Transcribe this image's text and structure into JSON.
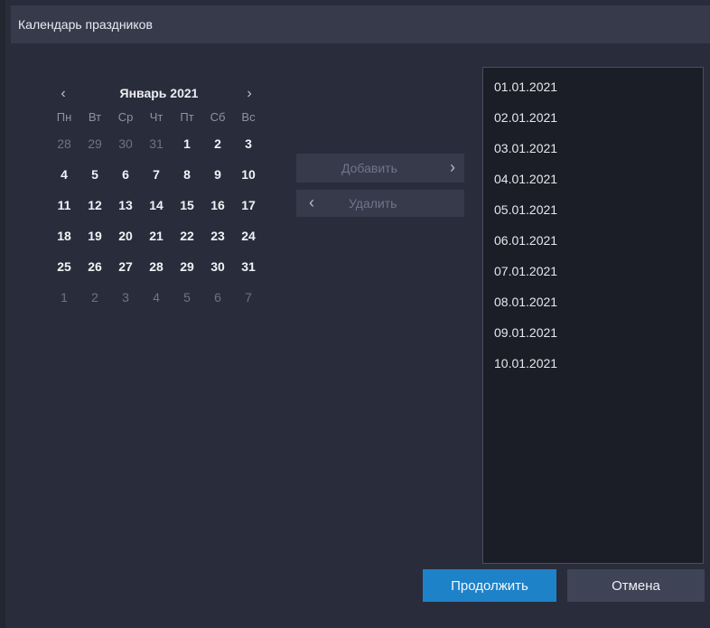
{
  "window": {
    "title": "Календарь праздников"
  },
  "calendar": {
    "month_label": "Январь 2021",
    "prev_icon": "chevron-left-icon",
    "next_icon": "chevron-right-icon",
    "weekdays": [
      "Пн",
      "Вт",
      "Ср",
      "Чт",
      "Пт",
      "Сб",
      "Вс"
    ],
    "weeks": [
      [
        {
          "d": "28",
          "out": true
        },
        {
          "d": "29",
          "out": true
        },
        {
          "d": "30",
          "out": true
        },
        {
          "d": "31",
          "out": true
        },
        {
          "d": "1"
        },
        {
          "d": "2"
        },
        {
          "d": "3"
        }
      ],
      [
        {
          "d": "4"
        },
        {
          "d": "5"
        },
        {
          "d": "6"
        },
        {
          "d": "7"
        },
        {
          "d": "8"
        },
        {
          "d": "9"
        },
        {
          "d": "10"
        }
      ],
      [
        {
          "d": "11"
        },
        {
          "d": "12"
        },
        {
          "d": "13"
        },
        {
          "d": "14"
        },
        {
          "d": "15"
        },
        {
          "d": "16"
        },
        {
          "d": "17"
        }
      ],
      [
        {
          "d": "18"
        },
        {
          "d": "19"
        },
        {
          "d": "20"
        },
        {
          "d": "21"
        },
        {
          "d": "22"
        },
        {
          "d": "23"
        },
        {
          "d": "24"
        }
      ],
      [
        {
          "d": "25"
        },
        {
          "d": "26"
        },
        {
          "d": "27"
        },
        {
          "d": "28"
        },
        {
          "d": "29"
        },
        {
          "d": "30"
        },
        {
          "d": "31"
        }
      ],
      [
        {
          "d": "1",
          "out": true
        },
        {
          "d": "2",
          "out": true
        },
        {
          "d": "3",
          "out": true
        },
        {
          "d": "4",
          "out": true
        },
        {
          "d": "5",
          "out": true
        },
        {
          "d": "6",
          "out": true
        },
        {
          "d": "7",
          "out": true
        }
      ]
    ]
  },
  "actions": {
    "add_label": "Добавить",
    "remove_label": "Удалить"
  },
  "dates": [
    "01.01.2021",
    "02.01.2021",
    "03.01.2021",
    "04.01.2021",
    "05.01.2021",
    "06.01.2021",
    "07.01.2021",
    "08.01.2021",
    "09.01.2021",
    "10.01.2021"
  ],
  "footer": {
    "continue_label": "Продолжить",
    "cancel_label": "Отмена"
  },
  "colors": {
    "accent": "#1e82c8",
    "background": "#292c3a",
    "titlebar": "#363a4b",
    "list_background": "#1b1d27"
  }
}
